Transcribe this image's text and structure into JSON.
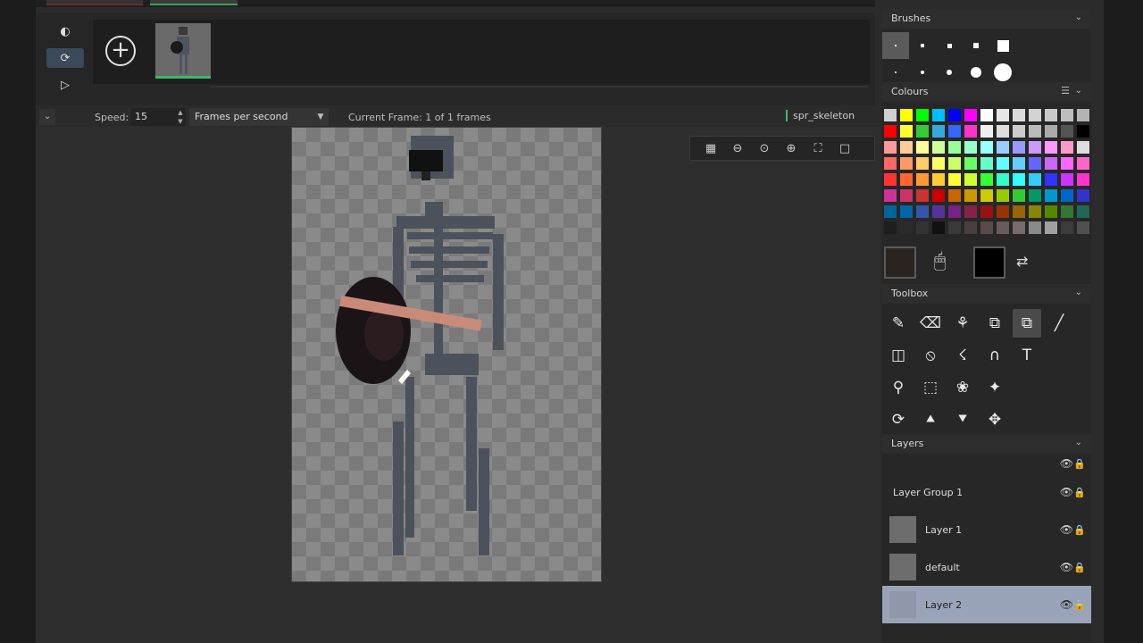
{
  "tabs": [
    "",
    ""
  ],
  "timeline": {
    "add_frame_symbol": "+",
    "buttons": [
      "onion-skin-icon",
      "loop-icon",
      "play-icon"
    ]
  },
  "options": {
    "speed_label": "Speed:",
    "speed_value": "15",
    "speed_mode": "Frames per second",
    "current_frame": "Current Frame: 1 of 1 frames",
    "sprite_name": "spr_skeleton"
  },
  "zoom_tools": [
    "grid-icon",
    "zoom-out-icon",
    "zoom-reset-icon",
    "zoom-in-icon",
    "fullscreen-icon",
    "background-icon"
  ],
  "brushes": {
    "title": "Brushes",
    "sizes": [
      1,
      2,
      3,
      4,
      6,
      1,
      2,
      3,
      5,
      7
    ]
  },
  "colours": {
    "title": "Colours",
    "palette": [
      "#d0d0d0",
      "#ffff00",
      "#00ff00",
      "#00c0ff",
      "#0000ff",
      "#ff00ff",
      "#ffffff",
      "#e6e6e6",
      "#dcdcdc",
      "#d2d2d2",
      "#c8c8c8",
      "#bebebe",
      "#b4b4b4",
      "#ff0000",
      "#ffff33",
      "#33cc33",
      "#33aadd",
      "#3366ff",
      "#ff33cc",
      "#f0f0f0",
      "#dddddd",
      "#cccccc",
      "#bbbbbb",
      "#aaaaaa",
      "#555555",
      "#000000",
      "#ff9999",
      "#ffcc99",
      "#ffff99",
      "#ccff99",
      "#99ff99",
      "#99ffcc",
      "#99ffff",
      "#99ccff",
      "#9999ff",
      "#cc99ff",
      "#ff99ff",
      "#ff99cc",
      "#dddddd",
      "#ff6666",
      "#ff9966",
      "#ffcc66",
      "#ffff66",
      "#ccff66",
      "#66ff66",
      "#66ffcc",
      "#66ffff",
      "#66ccff",
      "#6666ff",
      "#cc66ff",
      "#ff66ff",
      "#ff66cc",
      "#ff3333",
      "#ff6633",
      "#ff9933",
      "#ffcc33",
      "#ffff33",
      "#ccff33",
      "#33ff33",
      "#33ffcc",
      "#33ffff",
      "#33ccff",
      "#3333ff",
      "#cc33ff",
      "#ff33cc",
      "#cc3399",
      "#cc3366",
      "#cc3333",
      "#cc0000",
      "#cc6600",
      "#cc9900",
      "#cccc00",
      "#99cc00",
      "#33cc33",
      "#009966",
      "#0099cc",
      "#0066cc",
      "#3333cc",
      "#006699",
      "#0066aa",
      "#3355aa",
      "#553399",
      "#772288",
      "#882244",
      "#991111",
      "#993300",
      "#996600",
      "#888800",
      "#558800",
      "#337733",
      "#226655",
      "#1e1e1e",
      "#2a2a2a",
      "#333333",
      "#111111",
      "#3a3a3a",
      "#4a3f3f",
      "#5a4a4a",
      "#6a5a5a",
      "#7a6a6a",
      "#8a8a8a",
      "#a0a0a0",
      "#3c3c3c",
      "#505050"
    ],
    "primary": "#2a2420",
    "secondary": "#000000"
  },
  "toolbox": {
    "title": "Toolbox",
    "tools": [
      "pencil-icon",
      "eraser-icon",
      "fill-icon",
      "select-copy-icon",
      "select-move-icon",
      "line-icon",
      "rectangle-icon",
      "ellipse-icon",
      "spray-icon",
      "curve-icon",
      "text-icon",
      "",
      "eyedropper-icon",
      "marquee-icon",
      "lasso-icon",
      "magic-wand-icon",
      "",
      "",
      "rotate-icon",
      "flip-vertical-icon",
      "flip-horizontal-icon",
      "move-icon",
      "",
      ""
    ],
    "text_glyph": "T"
  },
  "layers": {
    "title": "Layers",
    "items": [
      {
        "name": "",
        "thumb": false,
        "selected": false
      },
      {
        "name": "Layer Group 1",
        "thumb": false,
        "selected": false
      },
      {
        "name": "Layer 1",
        "thumb": true,
        "selected": false
      },
      {
        "name": "default",
        "thumb": true,
        "selected": false
      },
      {
        "name": "Layer 2",
        "thumb": true,
        "selected": true
      }
    ]
  }
}
